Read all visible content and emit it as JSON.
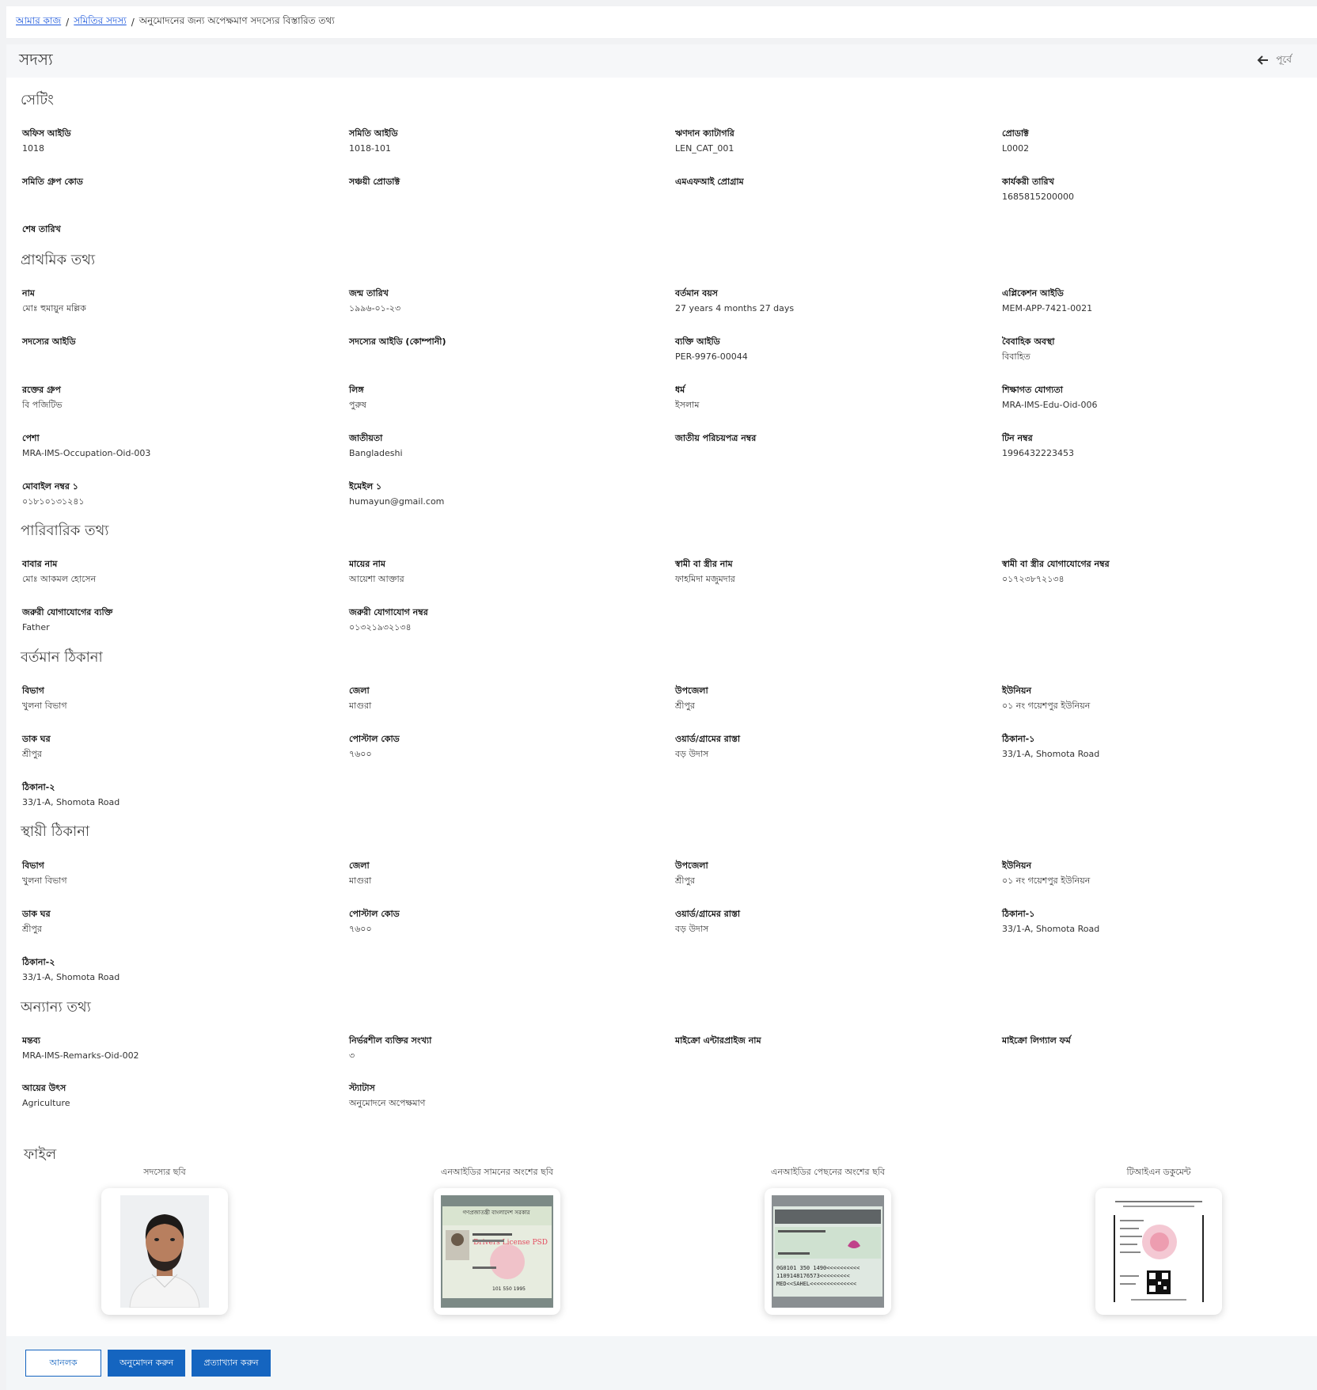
{
  "breadcrumb": {
    "home": "আমার কাজ",
    "members": "সমিতির সদস্য",
    "current": "অনুমোদনের জন্য অপেক্ষমাণ সদস্যের বিস্তারিত তথ্য"
  },
  "header": {
    "title": "সদস্য",
    "back_label": "পূর্বে"
  },
  "sections": {
    "settings": "সেটিং",
    "primary": "প্রাথমিক তথ্য",
    "family": "পারিবারিক তথ্য",
    "present_address": "বর্তমান ঠিকানা",
    "permanent_address": "স্থায়ী ঠিকানা",
    "other": "অন্যান্য তথ্য",
    "files": "ফাইল"
  },
  "settings": {
    "office_id": {
      "label": "অফিস আইডি",
      "value": "1018"
    },
    "samity_id": {
      "label": "সমিতি আইডি",
      "value": "1018-101"
    },
    "loan_category": {
      "label": "ঋণদান ক্যাটাগরি",
      "value": "LEN_CAT_001"
    },
    "product": {
      "label": "প্রোডাক্ট",
      "value": "L0002"
    },
    "group_code": {
      "label": "সমিতি গ্রুপ কোড",
      "value": ""
    },
    "savings_product": {
      "label": "সঞ্চয়ী প্রোডাক্ট",
      "value": ""
    },
    "mfi_program": {
      "label": "এমএফআই প্রোগ্রাম",
      "value": ""
    },
    "effective_date": {
      "label": "কার্যকরী তারিখ",
      "value": "1685815200000"
    },
    "end_date": {
      "label": "শেষ তারিখ",
      "value": ""
    }
  },
  "primary": {
    "name": {
      "label": "নাম",
      "value": "মোঃ হুমায়ুন মল্লিক"
    },
    "dob": {
      "label": "জন্ম তারিখ",
      "value": "১৯৯৬-০১-২৩"
    },
    "age": {
      "label": "বর্তমান বয়স",
      "value": "27 years 4 months 27 days"
    },
    "application_id": {
      "label": "এপ্লিকেশন আইডি",
      "value": "MEM-APP-7421-0021"
    },
    "member_id": {
      "label": "সদস্যের আইডি",
      "value": ""
    },
    "member_id_company": {
      "label": "সদস্যের আইডি (কোম্পানী)",
      "value": ""
    },
    "person_id": {
      "label": "ব্যক্তি আইডি",
      "value": "PER-9976-00044"
    },
    "marital": {
      "label": "বৈবাহিক অবস্থা",
      "value": "বিবাহিত"
    },
    "blood": {
      "label": "রক্তের গ্রুপ",
      "value": "বি পজিটিভ"
    },
    "gender": {
      "label": "লিঙ্গ",
      "value": "পুরুষ"
    },
    "religion": {
      "label": "ধর্ম",
      "value": "ইসলাম"
    },
    "education": {
      "label": "শিক্ষাগত যোগ্যতা",
      "value": "MRA-IMS-Edu-Oid-006"
    },
    "occupation": {
      "label": "পেশা",
      "value": "MRA-IMS-Occupation-Oid-003"
    },
    "nationality": {
      "label": "জাতীয়তা",
      "value": "Bangladeshi"
    },
    "nid": {
      "label": "জাতীয় পরিচয়পত্র নম্বর",
      "value": ""
    },
    "tin": {
      "label": "টিন নম্বর",
      "value": "1996432223453"
    },
    "mobile": {
      "label": "মোবাইল নম্বর ১",
      "value": "০১৮১০১৩১২৪১"
    },
    "email": {
      "label": "ইমেইল ১",
      "value": "humayun@gmail.com"
    }
  },
  "family": {
    "father": {
      "label": "বাবার নাম",
      "value": "মোঃ আকমল হোসেন"
    },
    "mother": {
      "label": "মায়ের নাম",
      "value": "আয়েশা আক্তার"
    },
    "spouse": {
      "label": "স্বামী বা স্ত্রীর নাম",
      "value": "ফাহমিদা মজুমদার"
    },
    "spouse_phone": {
      "label": "স্বামী বা স্ত্রীর যোগাযোগের নম্বর",
      "value": "০১৭২৩৮৭২১৩৪"
    },
    "emergency_person": {
      "label": "জরুরী যোগাযোগের ব্যক্তি",
      "value": "Father"
    },
    "emergency_phone": {
      "label": "জরুরী যোগাযোগ নম্বর",
      "value": "০১৩২১৯৩২১৩৪"
    }
  },
  "present_address": {
    "division": {
      "label": "বিভাগ",
      "value": "খুলনা বিভাগ"
    },
    "district": {
      "label": "জেলা",
      "value": "মাগুরা"
    },
    "upazila": {
      "label": "উপজেলা",
      "value": "শ্রীপুর"
    },
    "union": {
      "label": "ইউনিয়ন",
      "value": "০১ নং গয়েশপুর ইউনিয়ন"
    },
    "post_office": {
      "label": "ডাক ঘর",
      "value": "শ্রীপুর"
    },
    "postal_code": {
      "label": "পোস্টাল কোড",
      "value": "৭৬০০"
    },
    "ward": {
      "label": "ওয়ার্ড/গ্রামের রাস্তা",
      "value": "বড় উদাস"
    },
    "address1": {
      "label": "ঠিকানা-১",
      "value": "33/1-A, Shomota Road"
    },
    "address2": {
      "label": "ঠিকানা-২",
      "value": "33/1-A, Shomota Road"
    }
  },
  "permanent_address": {
    "division": {
      "label": "বিভাগ",
      "value": "খুলনা বিভাগ"
    },
    "district": {
      "label": "জেলা",
      "value": "মাগুরা"
    },
    "upazila": {
      "label": "উপজেলা",
      "value": "শ্রীপুর"
    },
    "union": {
      "label": "ইউনিয়ন",
      "value": "০১ নং গয়েশপুর ইউনিয়ন"
    },
    "post_office": {
      "label": "ডাক ঘর",
      "value": "শ্রীপুর"
    },
    "postal_code": {
      "label": "পোস্টাল কোড",
      "value": "৭৬০০"
    },
    "ward": {
      "label": "ওয়ার্ড/গ্রামের রাস্তা",
      "value": "বড় উদাস"
    },
    "address1": {
      "label": "ঠিকানা-১",
      "value": "33/1-A, Shomota Road"
    },
    "address2": {
      "label": "ঠিকানা-২",
      "value": "33/1-A, Shomota Road"
    }
  },
  "other": {
    "remarks": {
      "label": "মন্তব্য",
      "value": "MRA-IMS-Remarks-Oid-002"
    },
    "dependents": {
      "label": "নির্ভরশীল ব্যক্তির সংখ্যা",
      "value": "৩"
    },
    "enterprise_name": {
      "label": "মাইক্রো এন্টারপ্রাইজ নাম",
      "value": ""
    },
    "legal_form": {
      "label": "মাইক্রো লিগ্যাল ফর্ম",
      "value": ""
    },
    "income_source": {
      "label": "আয়ের উৎস",
      "value": "Agriculture"
    },
    "status": {
      "label": "স্ট্যাটাস",
      "value": "অনুমোদনে অপেক্ষমাণ"
    }
  },
  "files": {
    "photo": "সদস্যের ছবি",
    "nid_front": "এনআইডির সামনের অংশের ছবি",
    "nid_back": "এনআইডির পেছনের অংশের ছবি",
    "tin_doc": "টিআইএন ডকুমেন্ট",
    "nid_front_header": "গণপ্রজাতন্ত্রী বাংলাদেশ সরকার",
    "nid_front_watermark": "Drivers License PSD",
    "nid_front_number": "101 550 1995",
    "nid_back_mrz": [
      "0G0101 350 1490<<<<<<<<<<",
      "1109148176573<<<<<<<<<",
      "MED<<SAHEL<<<<<<<<<<<<<<"
    ]
  },
  "actions": {
    "reject_label": "আনলক",
    "approve_label": "অনুমোদন করুন",
    "decline_label": "প্রত্যাখ্যান করুন"
  },
  "colors": {
    "primary": "#1565c0",
    "link": "#1a56db"
  }
}
